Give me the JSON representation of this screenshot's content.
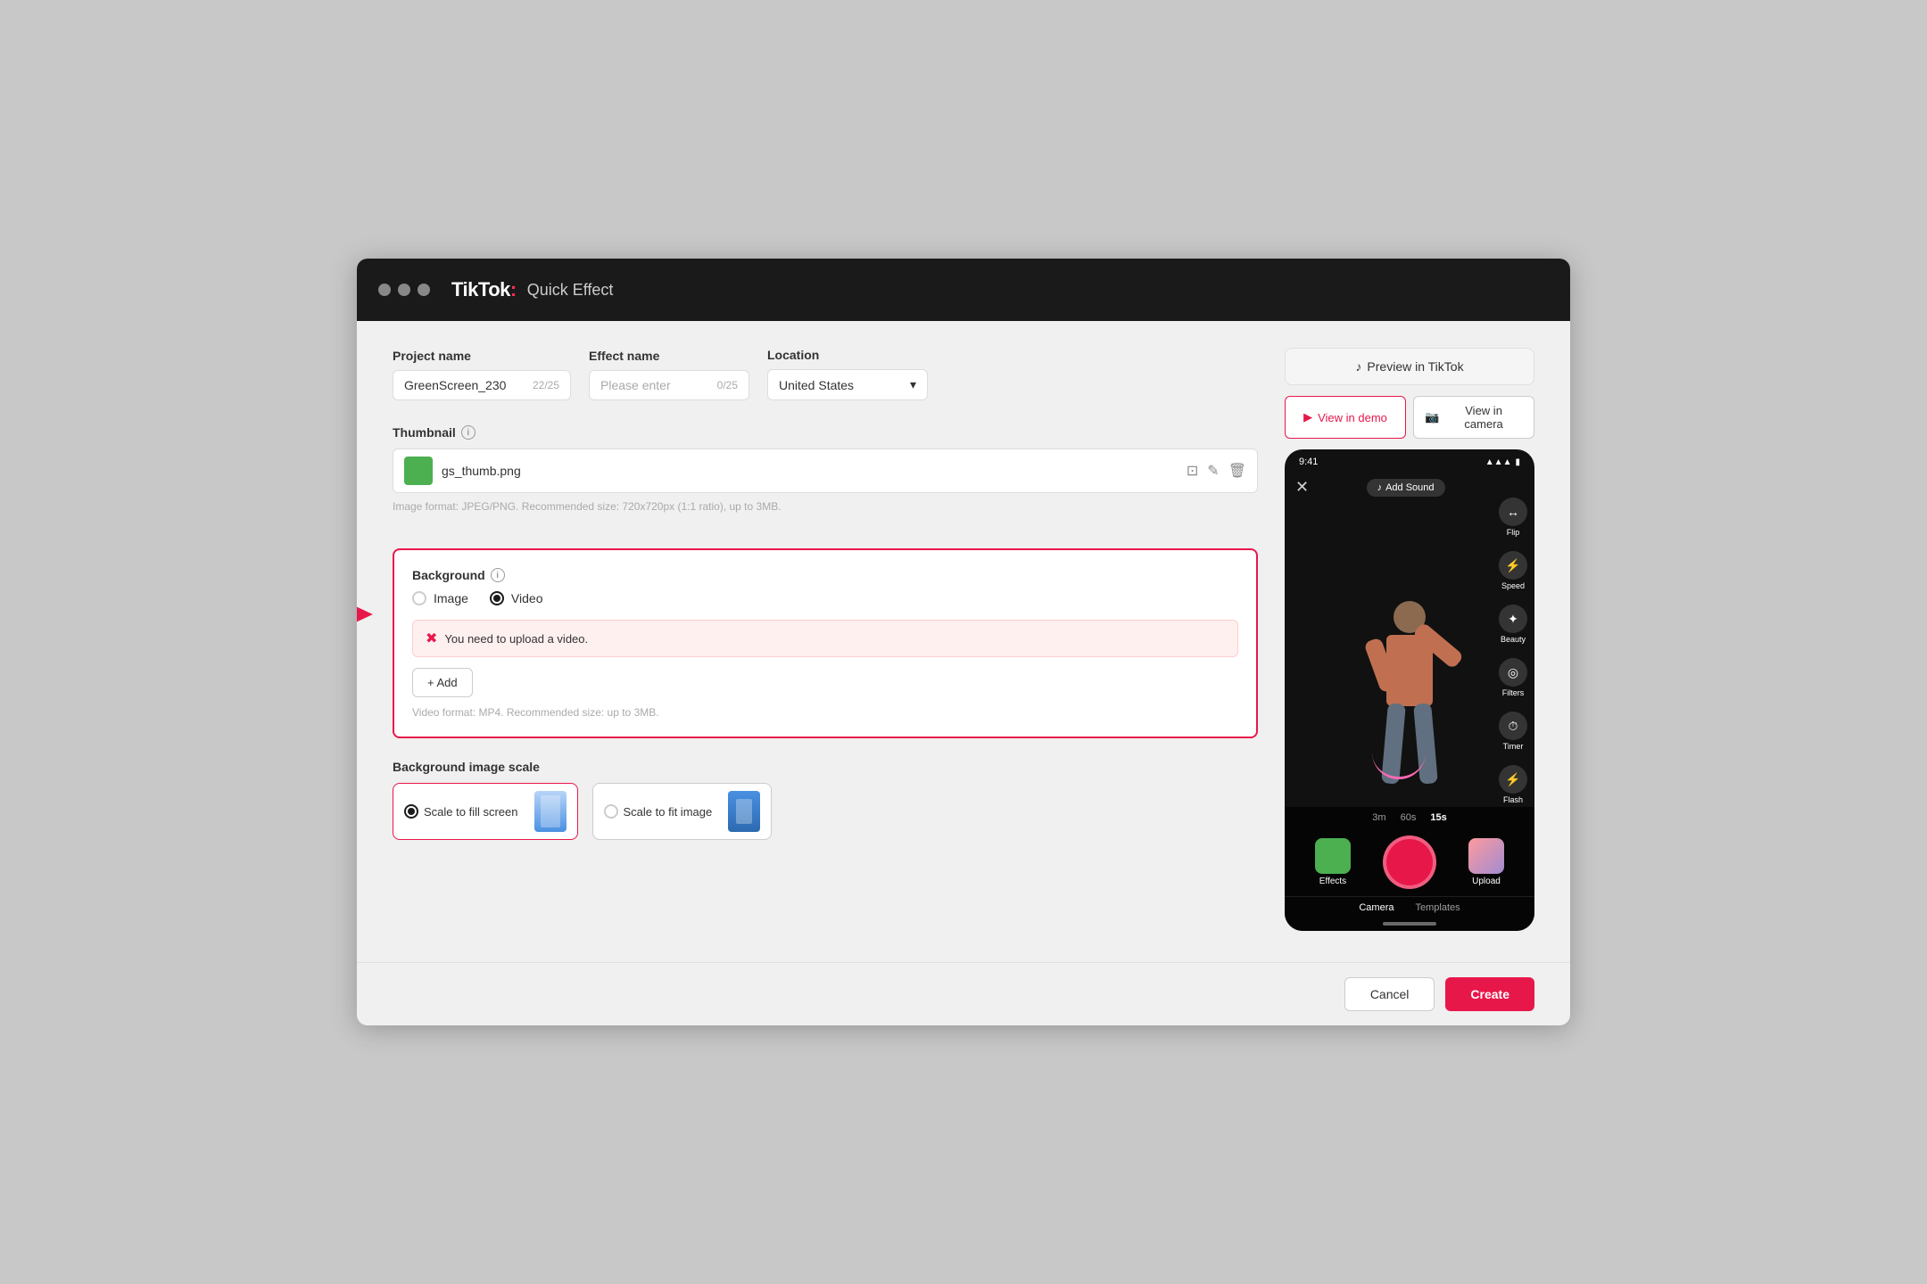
{
  "window": {
    "title": "TikTok: Quick Effect"
  },
  "header": {
    "brand": "TikTok",
    "colon": ":",
    "title": "Quick Effect"
  },
  "form": {
    "project_name_label": "Project name",
    "project_name_value": "GreenScreen_230",
    "project_name_count": "22/25",
    "effect_name_label": "Effect name",
    "effect_name_placeholder": "Please enter",
    "effect_name_count": "0/25",
    "location_label": "Location",
    "location_value": "United States",
    "thumbnail_label": "Thumbnail",
    "thumbnail_info": "?",
    "thumbnail_file": "gs_thumb.png",
    "thumbnail_hint": "Image format: JPEG/PNG. Recommended size: 720x720px (1:1 ratio), up to 3MB.",
    "background_label": "Background",
    "background_info": "?",
    "radio_image": "Image",
    "radio_video": "Video",
    "error_message": "You need to upload a video.",
    "add_button": "+ Add",
    "video_hint": "Video format: MP4. Recommended size: up to 3MB.",
    "scale_label": "Background image scale",
    "scale_fill": "Scale to fill screen",
    "scale_fit": "Scale to fit image"
  },
  "preview": {
    "header": "Preview in TikTok",
    "view_demo": "View in demo",
    "view_camera": "View in camera",
    "phone": {
      "time": "9:41",
      "signal": "●●●",
      "add_sound": "Add Sound",
      "timer_3m": "3m",
      "timer_60s": "60s",
      "timer_15s": "15s",
      "effects_label": "Effects",
      "upload_label": "Upload",
      "camera_tab": "Camera",
      "templates_tab": "Templates",
      "right_icons": [
        {
          "icon": "↻",
          "label": "Flip"
        },
        {
          "icon": "⚡",
          "label": "Speed"
        },
        {
          "icon": "✦",
          "label": "Beauty"
        },
        {
          "icon": "◎",
          "label": "Filters"
        },
        {
          "icon": "⏱",
          "label": "Timer"
        },
        {
          "icon": "✦",
          "label": "Flash"
        }
      ]
    }
  },
  "footer": {
    "cancel": "Cancel",
    "create": "Create"
  },
  "colors": {
    "accent": "#e8174a",
    "brand_black": "#1a1a1a",
    "selected_border": "#e8174a"
  }
}
